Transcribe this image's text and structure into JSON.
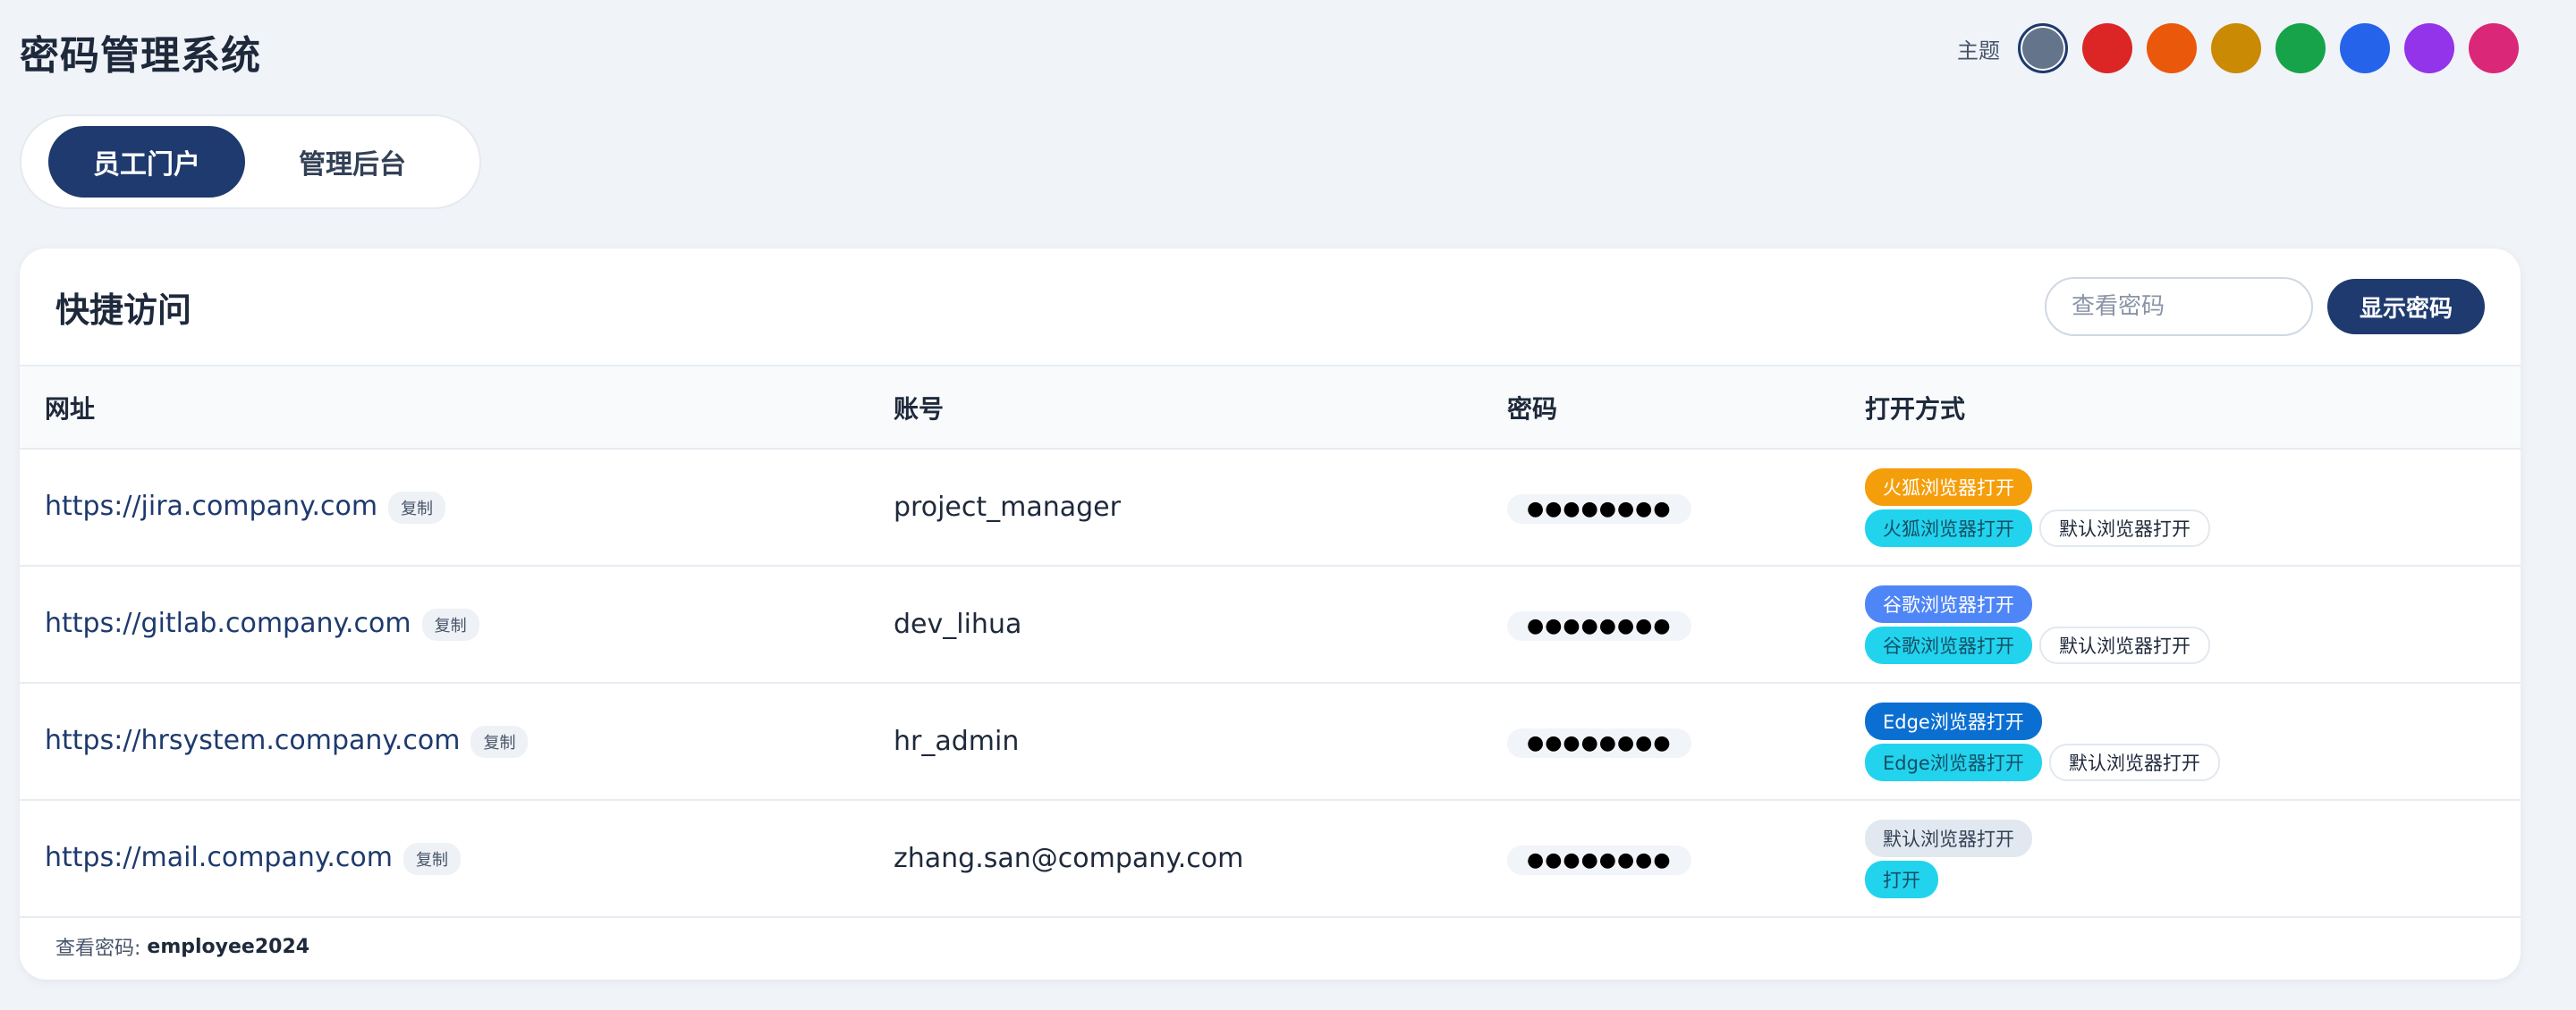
{
  "app": {
    "title": "密码管理系统"
  },
  "theme": {
    "label": "主题",
    "swatches": [
      {
        "name": "slate",
        "color": "#64748b",
        "active": true
      },
      {
        "name": "red",
        "color": "#dc2626"
      },
      {
        "name": "orange",
        "color": "#ea580c"
      },
      {
        "name": "amber",
        "color": "#ca8a04"
      },
      {
        "name": "green",
        "color": "#16a34a"
      },
      {
        "name": "blue",
        "color": "#2563eb"
      },
      {
        "name": "purple",
        "color": "#9333ea"
      },
      {
        "name": "pink",
        "color": "#db2777"
      }
    ]
  },
  "portal_tabs": {
    "employee": "员工门户",
    "admin": "管理后台",
    "active": "employee"
  },
  "card": {
    "title": "快捷访问",
    "password_input_placeholder": "查看密码",
    "show_password_label": "显示密码"
  },
  "table": {
    "headers": {
      "url": "网址",
      "account": "账号",
      "password": "密码",
      "open": "打开方式"
    },
    "copy_label": "复制",
    "rows": [
      {
        "url": "https://jira.company.com",
        "account": "project_manager",
        "password_mask": "●●●●●●●●",
        "primary_open": "火狐浏览器打开",
        "secondary_open": "火狐浏览器打开",
        "default_open": "默认浏览器打开"
      },
      {
        "url": "https://gitlab.company.com",
        "account": "dev_lihua",
        "password_mask": "●●●●●●●●",
        "primary_open": "谷歌浏览器打开",
        "secondary_open": "谷歌浏览器打开",
        "default_open": "默认浏览器打开"
      },
      {
        "url": "https://hrsystem.company.com",
        "account": "hr_admin",
        "password_mask": "●●●●●●●●",
        "primary_open": "Edge浏览器打开",
        "secondary_open": "Edge浏览器打开",
        "default_open": "默认浏览器打开"
      },
      {
        "url": "https://mail.company.com",
        "account": "zhang.san@company.com",
        "password_mask": "●●●●●●●●",
        "primary_open": "默认浏览器打开",
        "secondary_open": "打开"
      }
    ]
  },
  "footer": {
    "label": "查看密码: ",
    "value": "employee2024"
  }
}
